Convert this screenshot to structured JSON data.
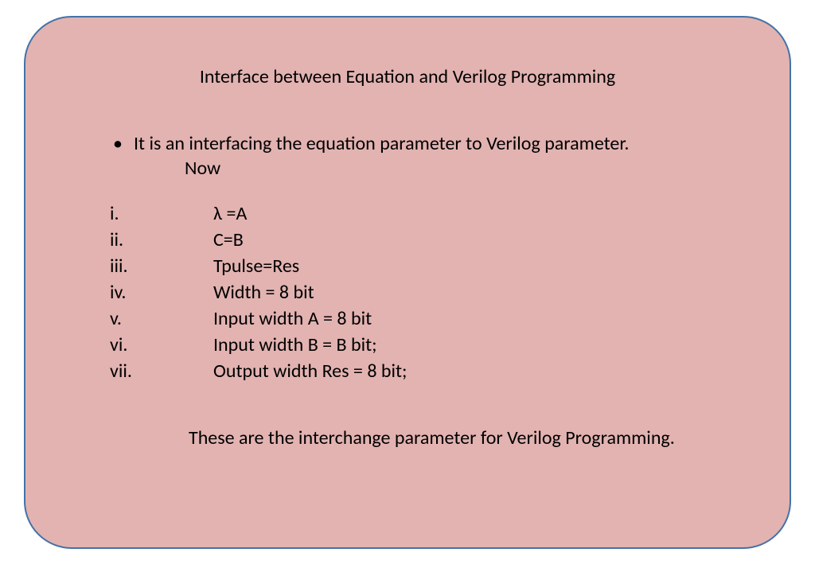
{
  "title": "Interface between Equation and Verilog Programming",
  "bullet": "It is an interfacing the equation parameter to Verilog parameter.",
  "now": "Now",
  "roman": {
    "i": {
      "num": "i.",
      "text": "λ =A"
    },
    "ii": {
      "num": "ii.",
      "text": "C=B"
    },
    "iii": {
      "num": "iii.",
      "text": "Tpulse=Res"
    },
    "iv": {
      "num": "iv.",
      "text": "Width = 8 bit"
    },
    "v": {
      "num": "v.",
      "text": "Input width A = 8 bit"
    },
    "vi": {
      "num": "vi.",
      "text": "Input width B = B bit;"
    },
    "vii": {
      "num": "vii.",
      "text": "Output width Res = 8 bit;"
    }
  },
  "footer": "These are the interchange parameter for Verilog Programming."
}
